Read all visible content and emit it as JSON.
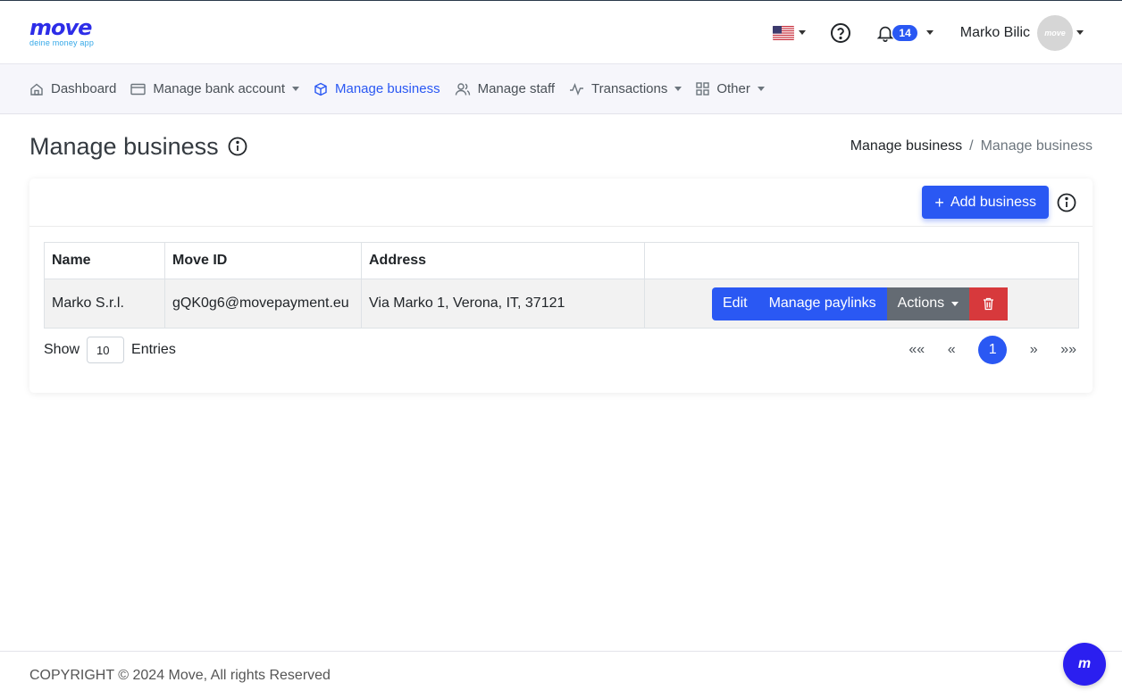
{
  "brand": {
    "name": "move",
    "tagline": "deine money app"
  },
  "header": {
    "notifications_count": "14",
    "user_name": "Marko Bilic",
    "avatar_text": "move"
  },
  "nav": {
    "items": [
      {
        "label": "Dashboard"
      },
      {
        "label": "Manage bank account"
      },
      {
        "label": "Manage business"
      },
      {
        "label": "Manage staff"
      },
      {
        "label": "Transactions"
      },
      {
        "label": "Other"
      }
    ]
  },
  "page": {
    "title": "Manage business",
    "breadcrumb": [
      "Manage business",
      "Manage business"
    ]
  },
  "card": {
    "add_label": "Add business",
    "columns": [
      "Name",
      "Move ID",
      "Address",
      ""
    ],
    "rows": [
      {
        "name": "Marko S.r.l.",
        "move_id": "gQK0g6@movepayment.eu",
        "address": "Via Marko 1, Verona, IT, 37121"
      }
    ],
    "row_actions": {
      "edit": "Edit",
      "paylinks": "Manage paylinks",
      "actions": "Actions"
    },
    "show_label": "Show",
    "page_size": "10",
    "entries_label": "Entries",
    "pager": {
      "first": "««",
      "prev": "«",
      "current": "1",
      "next": "»",
      "last": "»»"
    }
  },
  "footer": {
    "copyright": "COPYRIGHT © 2024 Move, All rights Reserved"
  },
  "colors": {
    "primary": "#2a58f3",
    "danger": "#d7393c",
    "secondary": "#646b73",
    "fab": "#2b1ff0"
  }
}
